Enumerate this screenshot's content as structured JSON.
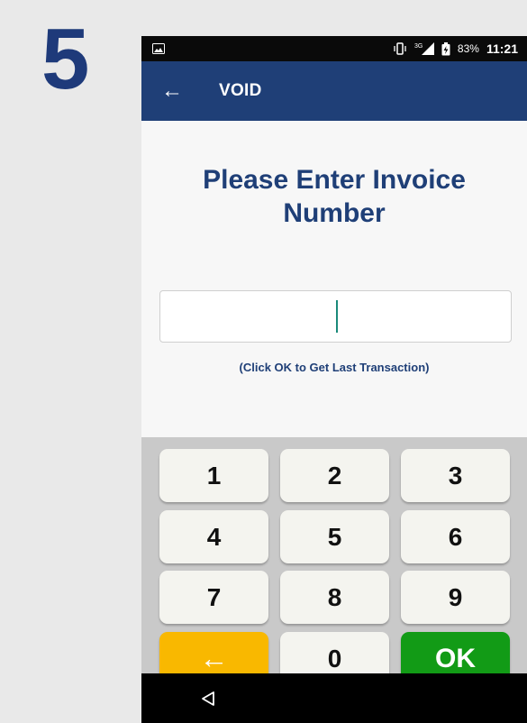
{
  "step": {
    "number": "5"
  },
  "status_bar": {
    "network": "3G",
    "battery_percent": "83%",
    "time": "11:21"
  },
  "app_bar": {
    "title": "VOID"
  },
  "content": {
    "prompt_line1": "Please Enter Invoice",
    "prompt_line2": "Number",
    "input_value": "",
    "hint": "(Click OK to Get Last Transaction)"
  },
  "keypad": {
    "keys": [
      "1",
      "2",
      "3",
      "4",
      "5",
      "6",
      "7",
      "8",
      "9",
      "←",
      "0",
      "OK"
    ]
  },
  "colors": {
    "app_bar": "#1f3f77",
    "backspace_key": "#f9b800",
    "ok_key": "#129b16"
  }
}
